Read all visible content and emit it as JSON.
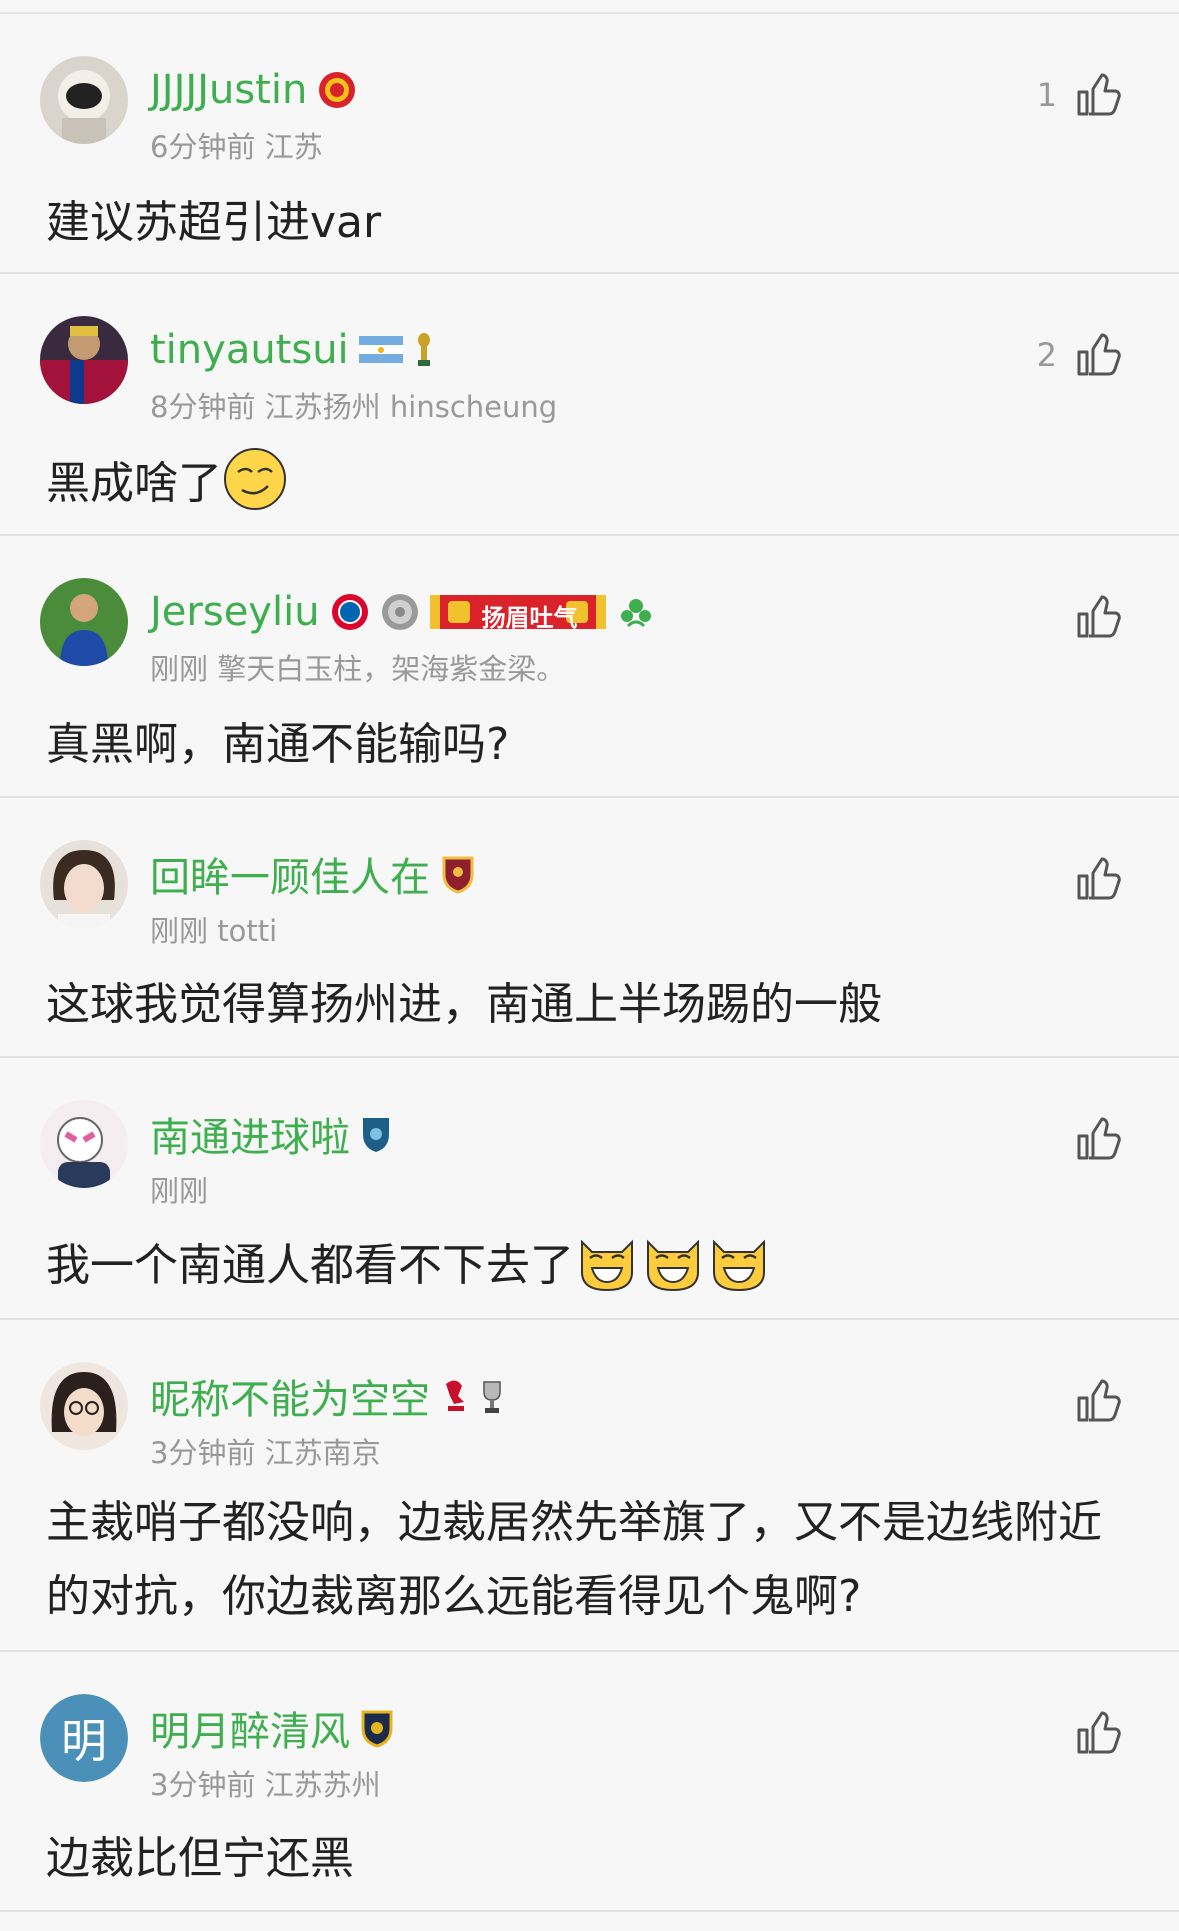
{
  "comments": [
    {
      "name": "JJJJJustin",
      "meta": "6分钟前 江苏",
      "likes": "1",
      "text": "建议苏超引进var",
      "badges": [
        "manchester-united-badge-icon"
      ]
    },
    {
      "name": "tinyautsui",
      "meta": "8分钟前 江苏扬州 hinscheung",
      "likes": "2",
      "text": "黑成啥了",
      "badges": [
        "argentina-flag-icon",
        "world-cup-trophy-icon"
      ],
      "emoji": "smirk-emoji"
    },
    {
      "name": "Jerseyliu",
      "meta": "刚刚 擎天白玉柱，架海紫金梁。",
      "likes": "",
      "text": "真黑啊，南通不能输吗?",
      "badges": [
        "bayern-badge-icon",
        "bundesliga-plate-icon",
        "yangzhou-scarf-badge-icon",
        "club-crest-icon"
      ],
      "scarf_text": "扬眉吐气"
    },
    {
      "name": "回眸一顾佳人在",
      "meta": "刚刚 totti",
      "likes": "",
      "text": "这球我觉得算扬州进，南通上半场踢的一般",
      "badges": [
        "as-roma-badge-icon"
      ]
    },
    {
      "name": "南通进球啦",
      "meta": "刚刚",
      "likes": "",
      "text": "我一个南通人都看不下去了",
      "badges": [
        "nantong-badge-icon"
      ],
      "emoji": "grinning-cat-emoji"
    },
    {
      "name": "昵称不能为空空",
      "meta": "3分钟前 江苏南京",
      "likes": "",
      "text": "主裁哨子都没响，边裁居然先举旗了，又不是边线附近的对抗，你边裁离那么远能看得见个鬼啊?",
      "badges": [
        "liverpool-badge-icon",
        "premier-league-trophy-icon"
      ]
    },
    {
      "name": "明月醉清风",
      "meta": "3分钟前 江苏苏州",
      "likes": "",
      "text": "边裁比但宁还黑",
      "badges": [
        "jiangsu-club-badge-icon"
      ],
      "avatar_letter": "明"
    }
  ],
  "colors": {
    "name": "#3fae4f",
    "meta": "#999999",
    "text": "#222222",
    "background": "#f7f7f7"
  }
}
